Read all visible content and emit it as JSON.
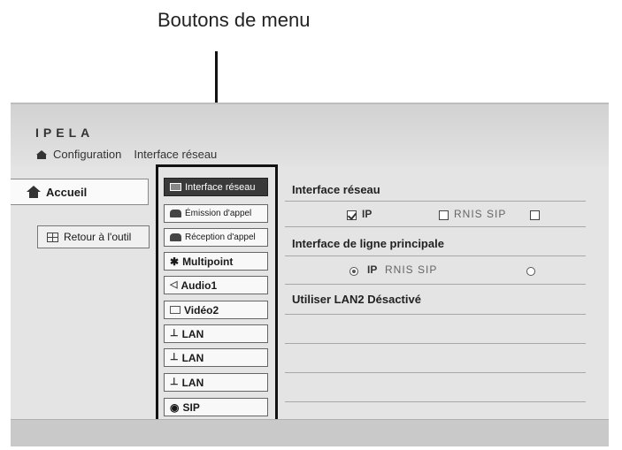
{
  "callout": {
    "label": "Boutons de menu"
  },
  "header": {
    "logo": "IPELA",
    "breadcrumb_root": "Configuration",
    "breadcrumb_current": "Interface réseau"
  },
  "sidebar": {
    "home_label": "Accueil",
    "return_label": "Retour à l'outil"
  },
  "menu": {
    "items": [
      {
        "label": "Interface réseau",
        "icon": "network-icon",
        "active": true
      },
      {
        "label": "Émission d'appel",
        "icon": "outgoing-call-icon"
      },
      {
        "label": "Réception d'appel",
        "icon": "incoming-call-icon"
      },
      {
        "label": "Multipoint",
        "icon": "multipoint-icon"
      },
      {
        "label": "Audio1",
        "icon": "speaker-icon"
      },
      {
        "label": "Vidéo2",
        "icon": "video-icon"
      },
      {
        "label": "LAN",
        "icon": "lan-icon"
      },
      {
        "label": "LAN",
        "icon": "lan-icon"
      },
      {
        "label": "LAN",
        "icon": "lan-icon"
      },
      {
        "label": "SIP",
        "icon": "sip-icon"
      }
    ]
  },
  "content": {
    "section1_title": "Interface réseau",
    "section1_opt_ip": "IP",
    "section1_opt_rnis_sip": "RNIS SIP",
    "section2_title": "Interface de ligne principale",
    "section2_ip": "IP",
    "section2_rnis_sip": "RNIS SIP",
    "section3_title": "Utiliser LAN2 Désactivé"
  }
}
